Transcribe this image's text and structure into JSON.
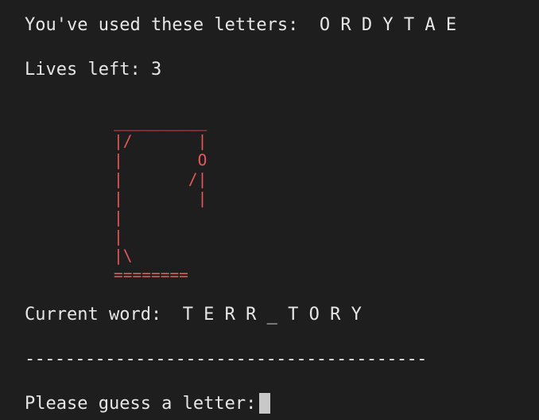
{
  "used_letters": {
    "label": "You've used these letters:",
    "letters": "O R D Y T A E"
  },
  "lives": {
    "label": "Lives left:",
    "count": "3"
  },
  "hangman": {
    "color": "#e8575a",
    "art": "__________\n|/       |\n|        O\n|       /|\n|        |\n|\n|\n|\\\n========"
  },
  "current_word": {
    "label": "Current word:",
    "value": "T E R R _ T O R Y"
  },
  "divider": "----------------------------------------",
  "prompt": {
    "label": "Please guess a letter:"
  }
}
